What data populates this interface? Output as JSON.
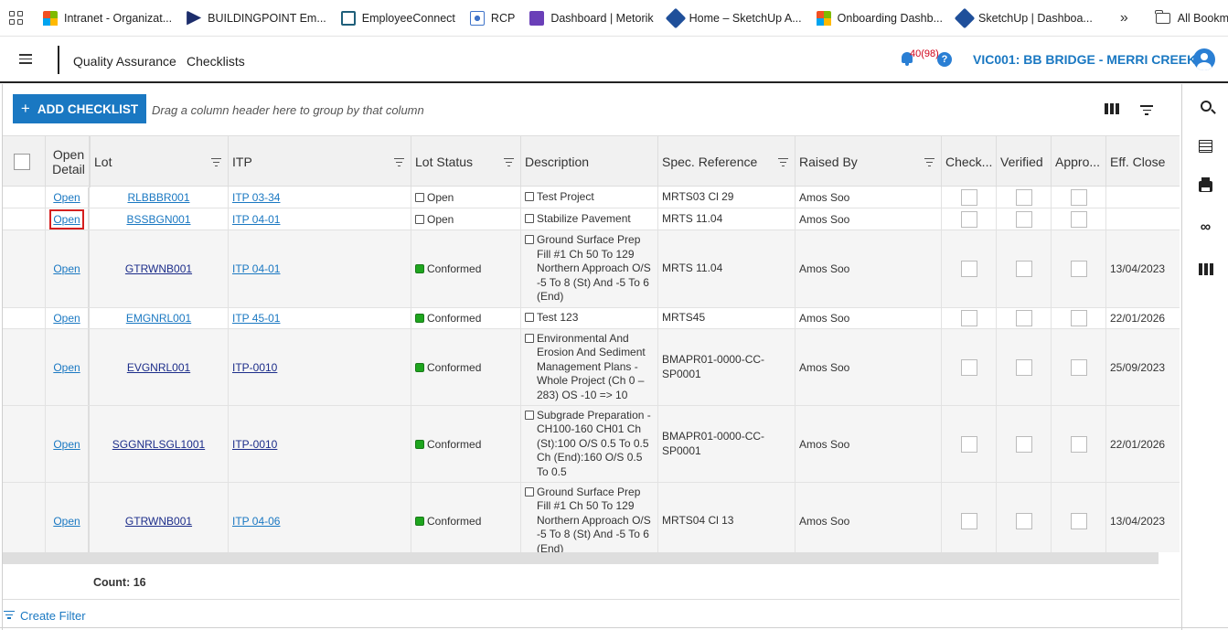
{
  "bookmarks": {
    "items": [
      {
        "label": "Intranet - Organizat...",
        "icon": "microsoft-icon"
      },
      {
        "label": "BUILDINGPOINT Em...",
        "icon": "buildingpoint-icon"
      },
      {
        "label": "EmployeeConnect",
        "icon": "employeeconnect-icon"
      },
      {
        "label": "RCP",
        "icon": "rcp-icon"
      },
      {
        "label": "Dashboard | Metorik",
        "icon": "metorik-icon"
      },
      {
        "label": "Home – SketchUp A...",
        "icon": "sketchup-icon"
      },
      {
        "label": "Onboarding Dashb...",
        "icon": "microsoft-icon"
      },
      {
        "label": "SketchUp | Dashboa...",
        "icon": "sketchup-icon"
      }
    ],
    "more": "»",
    "all_bookmarks": "All Bookmarks"
  },
  "header": {
    "breadcrumb_1": "Quality Assurance",
    "breadcrumb_2": "Checklists",
    "notification_count": "40(98)",
    "help": "?",
    "project": "VIC001: BB BRIDGE - MERRI CREEK"
  },
  "toolbar": {
    "add_label": "ADD CHECKLIST",
    "add_plus": "+",
    "group_hint": "Drag a column header here to group by that column"
  },
  "columns": [
    "Open Detail",
    "Lot",
    "ITP",
    "Lot Status",
    "Description",
    "Spec. Reference",
    "Raised By",
    "Check...",
    "Verified",
    "Appro...",
    "Eff. Close"
  ],
  "rows": [
    {
      "open": "Open",
      "lot": "RLBBBR001",
      "itp": "ITP 03-34",
      "status": "Open",
      "desc": "Test Project",
      "spec": "MRTS03 Cl 29",
      "raised": "Amos Soo",
      "eff_close": ""
    },
    {
      "open": "Open",
      "lot": "BSSBGN001",
      "itp": "ITP 04-01",
      "status": "Open",
      "desc": "Stabilize Pavement",
      "spec": "MRTS 11.04",
      "raised": "Amos Soo",
      "eff_close": ""
    },
    {
      "open": "Open",
      "lot": "GTRWNB001",
      "itp": "ITP 04-01",
      "status": "Conformed",
      "desc": "Ground Surface Prep Fill #1 Ch 50 To 129 Northern Approach O/S -5 To 8 (St) And -5 To 6 (End)",
      "spec": "MRTS 11.04",
      "raised": "Amos Soo",
      "eff_close": "13/04/2023"
    },
    {
      "open": "Open",
      "lot": "EMGNRL001",
      "itp": "ITP 45-01",
      "status": "Conformed",
      "desc": "Test 123",
      "spec": "MRTS45",
      "raised": "Amos Soo",
      "eff_close": "22/01/2026"
    },
    {
      "open": "Open",
      "lot": "EVGNRL001",
      "itp": "ITP-0010",
      "status": "Conformed",
      "desc": "Environmental And Erosion And Sediment Management Plans - Whole Project (Ch 0 – 283) OS -10 => 10",
      "spec": "BMAPR01-0000-CC-SP0001",
      "raised": "Amos Soo",
      "eff_close": "25/09/2023"
    },
    {
      "open": "Open",
      "lot": "SGGNRLSGL1001",
      "itp": "ITP-0010",
      "status": "Conformed",
      "desc": "Subgrade Preparation - CH100-160 CH01 Ch (St):100 O/S 0.5 To 0.5 Ch (End):160 O/S 0.5 To 0.5",
      "spec": "BMAPR01-0000-CC-SP0001",
      "raised": "Amos Soo",
      "eff_close": "22/01/2026"
    },
    {
      "open": "Open",
      "lot": "GTRWNB001",
      "itp": "ITP 04-06",
      "status": "Conformed",
      "desc": "Ground Surface Prep Fill #1 Ch 50 To 129 Northern Approach O/S -5 To 8 (St) And -5 To 6 (End)",
      "spec": "MRTS04 Cl 13",
      "raised": "Amos Soo",
      "eff_close": "13/04/2023"
    }
  ],
  "footer": {
    "count": "Count: 16",
    "create_filter": "Create Filter"
  }
}
